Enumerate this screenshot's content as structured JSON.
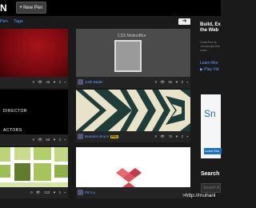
{
  "header": {
    "logo": "N",
    "new_pen_label": "New Pen",
    "new_pen_icon": "plus-icon"
  },
  "nav": {
    "items": [
      {
        "label": "Pen"
      },
      {
        "label": "Tags"
      }
    ],
    "arrow": "➜"
  },
  "pens": [
    {
      "author": "",
      "views": "0",
      "likes": "46",
      "comments": "2"
    },
    {
      "title": "CSS MotionBlur",
      "author": "Josh Bader",
      "views": "0",
      "likes": "65",
      "comments": "0"
    },
    {
      "line1": "DIRECTOR",
      "line2": "ACTORS",
      "author": "",
      "views": "0",
      "likes": "68",
      "comments": "3"
    },
    {
      "author": "Brandon Bruce",
      "badge": "PRO",
      "views": "0",
      "likes": "75",
      "comments": "2"
    },
    {
      "author": "",
      "views": "0",
      "likes": "132",
      "comments": "1"
    },
    {
      "author": "Pirt Lu",
      "views": "0",
      "likes": "",
      "comments": ""
    }
  ],
  "sidebar": {
    "title": "Build, Ex the Web",
    "text": "CodePen is Javascript the code",
    "link_learn": "Learn Mor",
    "link_video": "▶ Play Vid"
  },
  "ad": {
    "text": "Sn",
    "button": "Learn Mor"
  },
  "search": {
    "label": "Search",
    "placeholder": "Search A"
  },
  "watermark": ">http://muhanl",
  "colors": {
    "link": "#5aa0ff",
    "background": "#1a1a1a",
    "pro_badge": "#d8b800"
  }
}
